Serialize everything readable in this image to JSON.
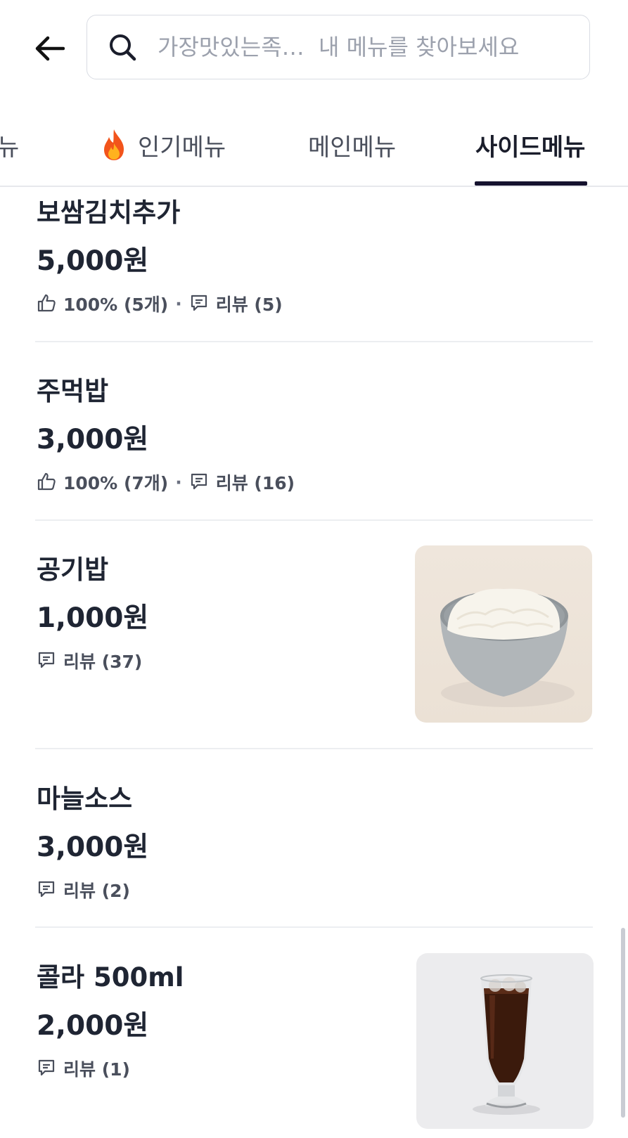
{
  "header": {
    "back_icon": "arrow-left-icon",
    "search_icon": "search-icon",
    "search_placeholder": "가장맛있는족…  내 메뉴를 찾아보세요"
  },
  "tabs": [
    {
      "label": "뉴",
      "active": false
    },
    {
      "label": "인기메뉴",
      "icon": "fire-icon",
      "active": false
    },
    {
      "label": "메인메뉴",
      "active": false
    },
    {
      "label": "사이드메뉴",
      "active": true
    }
  ],
  "items": [
    {
      "name": "보쌈김치추가",
      "price": "5,000원",
      "like": "100% (5개)",
      "review": "리뷰 (5)"
    },
    {
      "name": "주먹밥",
      "price": "3,000원",
      "like": "100% (7개)",
      "review": "리뷰 (16)"
    },
    {
      "name": "공기밥",
      "price": "1,000원",
      "review": "리뷰 (37)",
      "image": "rice-bowl-photo"
    },
    {
      "name": "마늘소스",
      "price": "3,000원",
      "review": "리뷰 (2)"
    },
    {
      "name": "콜라 500ml",
      "price": "2,000원",
      "review": "리뷰 (1)",
      "image": "cola-glass-photo"
    }
  ],
  "colors": {
    "text": "#1f2533",
    "active_indicator": "#15122e",
    "divider": "#eceef1"
  }
}
